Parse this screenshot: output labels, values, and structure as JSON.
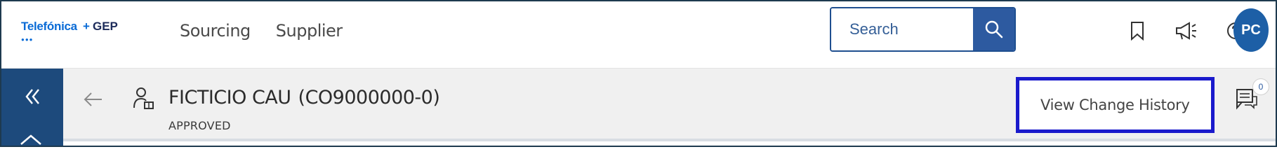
{
  "header": {
    "logo": {
      "brand_left": "Telefónica",
      "plus": "+",
      "brand_right": "GEP",
      "dots": "●●●"
    },
    "nav": [
      {
        "label": "Sourcing"
      },
      {
        "label": "Supplier"
      }
    ],
    "search": {
      "placeholder": "Search",
      "value": ""
    },
    "icons": [
      "bookmark-icon",
      "megaphone-icon",
      "help-icon"
    ],
    "avatar_initials": "PC"
  },
  "subheader": {
    "title_name": "FICTICIO CAU",
    "title_code": "(CO9000000-0)",
    "status": "APPROVED",
    "view_change_history": "View Change History",
    "comment_count": "0"
  },
  "colors": {
    "primary": "#2d5aa0",
    "sidebar": "#1d4a7c",
    "highlight_border": "#1a1acc",
    "avatar": "#1d5fa6"
  }
}
